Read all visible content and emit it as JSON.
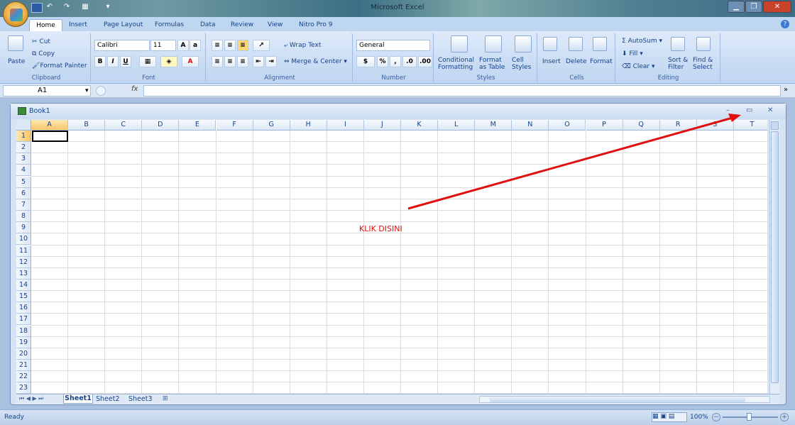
{
  "window": {
    "title": "Microsoft Excel"
  },
  "tabs": [
    "Home",
    "Insert",
    "Page Layout",
    "Formulas",
    "Data",
    "Review",
    "View",
    "Nitro Pro 9"
  ],
  "clipboard": {
    "paste": "Paste",
    "cut": "Cut",
    "copy": "Copy",
    "format_painter": "Format Painter",
    "label": "Clipboard"
  },
  "font": {
    "name": "Calibri",
    "size": "11",
    "label": "Font"
  },
  "alignment": {
    "wrap_text": "Wrap Text",
    "merge_center": "Merge & Center",
    "label": "Alignment"
  },
  "number": {
    "format": "General",
    "label": "Number"
  },
  "styles": {
    "conditional": "Conditional",
    "formatting": "Formatting",
    "format": "Format",
    "as_table": "as Table",
    "cell": "Cell",
    "cell_styles": "Styles",
    "label": "Styles"
  },
  "cells": {
    "insert": "Insert",
    "delete": "Delete",
    "format": "Format",
    "label": "Cells"
  },
  "editing": {
    "autosum": "AutoSum",
    "fill": "Fill",
    "clear": "Clear",
    "sort": "Sort &",
    "filter": "Filter",
    "find": "Find &",
    "select": "Select",
    "label": "Editing"
  },
  "formula_bar": {
    "name_box": "A1",
    "fx": "fx",
    "value": ""
  },
  "workbook": {
    "title": "Book1"
  },
  "columns": [
    "A",
    "B",
    "C",
    "D",
    "E",
    "F",
    "G",
    "H",
    "I",
    "J",
    "K",
    "L",
    "M",
    "N",
    "O",
    "P",
    "Q",
    "R",
    "S",
    "T"
  ],
  "rows": [
    "1",
    "2",
    "3",
    "4",
    "5",
    "6",
    "7",
    "8",
    "9",
    "10",
    "11",
    "12",
    "13",
    "14",
    "15",
    "16",
    "17",
    "18",
    "19",
    "20",
    "21",
    "22",
    "23"
  ],
  "sheets": [
    "Sheet1",
    "Sheet2",
    "Sheet3"
  ],
  "status": {
    "text": "Ready",
    "zoom": "100%"
  },
  "annotation": {
    "text": "KLIK DISINI",
    "color": "#e01010"
  }
}
